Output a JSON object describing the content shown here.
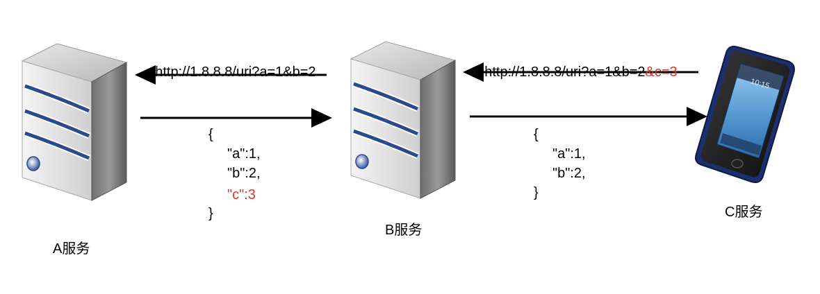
{
  "nodes": {
    "a": {
      "label": "A服务",
      "icon": "server-icon"
    },
    "b": {
      "label": "B服务",
      "icon": "server-icon"
    },
    "c": {
      "label": "C服务",
      "icon": "smartphone-icon",
      "screen_time": "10:15"
    }
  },
  "requests": {
    "b_to_a": {
      "url": "http://1.8.8.8/uri?a=1&b=2"
    },
    "c_to_b": {
      "url": "http://1.8.8.8/uri?a=1&b=2",
      "extra_param": "&c=3"
    }
  },
  "responses": {
    "a_to_b": {
      "open": "{",
      "line1": "\"a\":1,",
      "line2": "\"b\":2,",
      "line3": "\"c\":3",
      "close": "}"
    },
    "b_to_c": {
      "open": "{",
      "line1": "\"a\":1,",
      "line2": "\"b\":2,",
      "close": "}"
    }
  },
  "colors": {
    "highlight": "#e0332a",
    "arrow": "#000000",
    "server_body": "#8a8a8a",
    "server_stripe": "#2b4a8c",
    "phone_frame": "#1d2f6e",
    "phone_screen": "#5fa4d8"
  }
}
